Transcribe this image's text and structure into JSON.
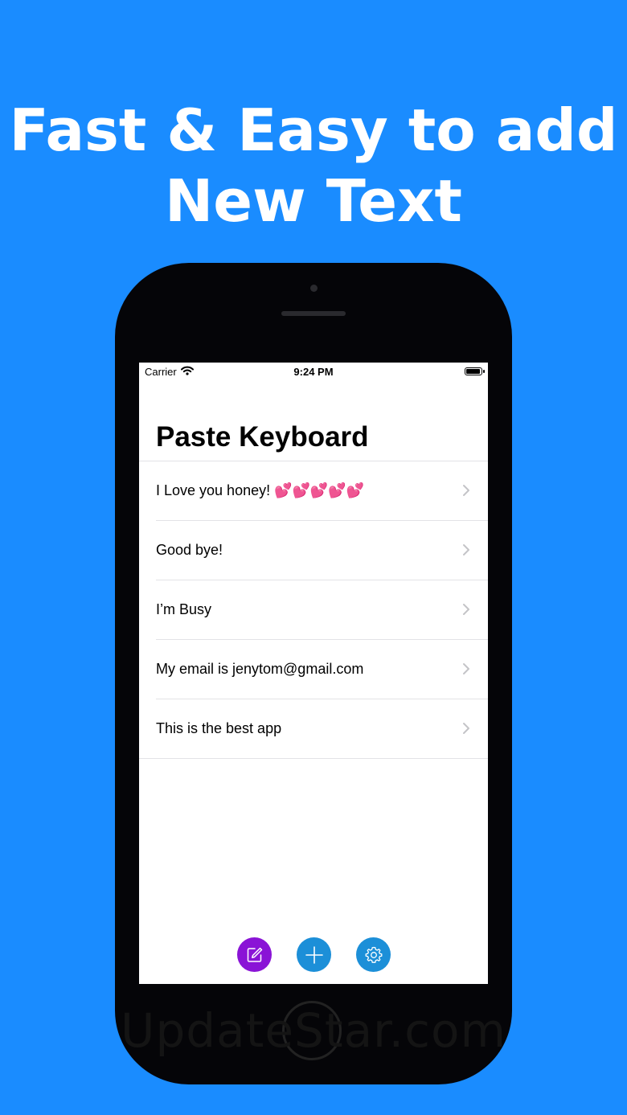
{
  "headline": {
    "line1": "Fast & Easy to add",
    "line2": "New Text"
  },
  "watermark": "UpdateStar.com",
  "status_bar": {
    "carrier": "Carrier",
    "time": "9:24 PM"
  },
  "app": {
    "title": "Paste Keyboard",
    "items": [
      {
        "label": "I Love you honey! 💕💕💕💕💕"
      },
      {
        "label": "Good bye!"
      },
      {
        "label": "I’m Busy"
      },
      {
        "label": "My email is jenytom@gmail.com"
      },
      {
        "label": "This is the best app"
      }
    ],
    "toolbar": {
      "edit_icon": "edit-icon",
      "add_icon": "plus-icon",
      "settings_icon": "gear-icon"
    }
  },
  "colors": {
    "background": "#1a8cff",
    "edit_button": "#8a14d6",
    "action_button": "#1c8fd8"
  }
}
